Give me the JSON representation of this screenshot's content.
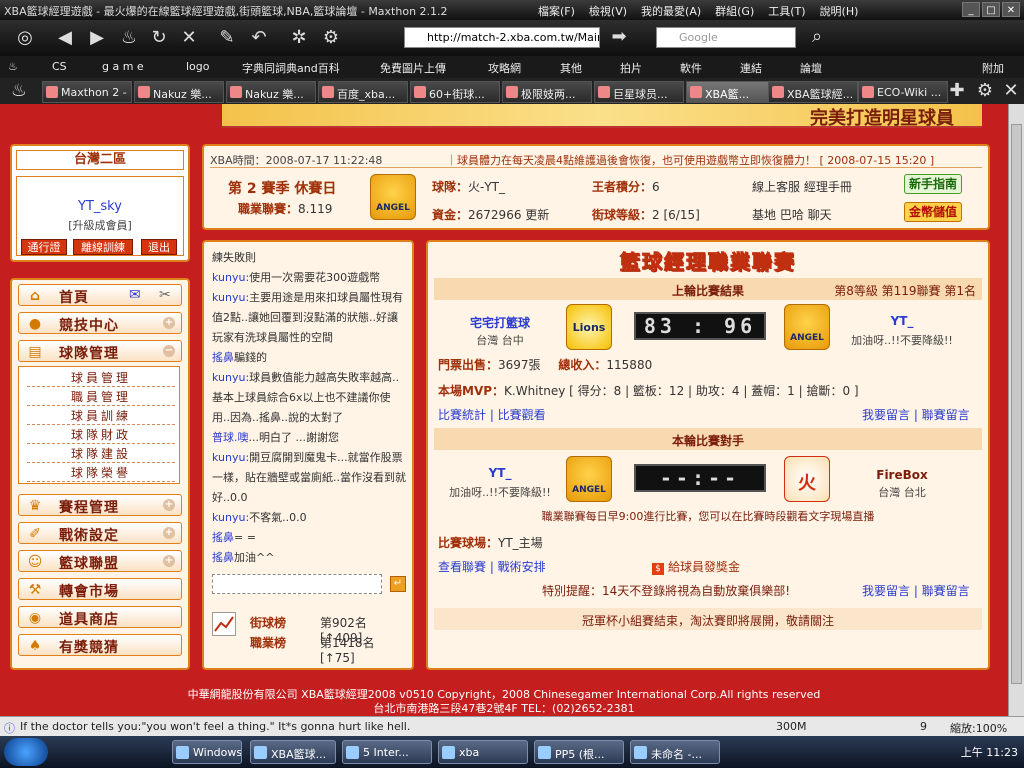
{
  "window": {
    "title": "XBA籃球經理遊戲 - 最火爆的在線籃球經理遊戲,街頭籃球,NBA,籃球論壇 - Maxthon 2.1.2",
    "menu": [
      "檔案(F)",
      "檢視(V)",
      "我的最愛(A)",
      "群組(G)",
      "工具(T)",
      "說明(H)"
    ]
  },
  "nav": {
    "url": "http://match-2.xba.com.tw/Mair",
    "search_placeholder": "Google"
  },
  "favorites": [
    "CS",
    "g a m e",
    "logo",
    "字典同詞典and百科",
    "免費圖片上傳",
    "攻略網",
    "其他",
    "拍片",
    "軟件",
    "連結",
    "論壇",
    "附加"
  ],
  "tabs": [
    "Maxthon 2 - ...",
    "Nakuz 樂...",
    "Nakuz 樂...",
    "百度_xba...",
    "60+街球...",
    "极限妓两...",
    "巨星球员...",
    "XBA籃...",
    "XBA籃球經...",
    "ECO-Wiki ..."
  ],
  "banner_text": "完美打造明星球員",
  "left": {
    "region": "台灣二區",
    "username": "YT_sky",
    "level": "[升級成會員]",
    "buttons": [
      "通行證",
      "離線訓練",
      "退出"
    ]
  },
  "menu": {
    "home": "首頁",
    "items": [
      "競技中心",
      "球隊管理",
      "賽程管理",
      "戰術設定",
      "籃球聯盟",
      "轉會市場",
      "道具商店",
      "有獎競猜"
    ],
    "sub": [
      "球員管理",
      "職員管理",
      "球員訓練",
      "球隊財政",
      "球隊建設",
      "球隊榮譽"
    ]
  },
  "info": {
    "time": "XBA時間：2008-07-17 11:22:48",
    "notice": "｜球員體力在每天凌晨4點維護過後會恢復，也可使用遊戲幣立即恢復體力！ [ 2008-07-15 15:20 ]",
    "season": "第 2 賽季  休賽日",
    "league_label": "職業聯賽：",
    "league_val": "8.119",
    "logo_text": "ANGEL",
    "team_label": "球隊：",
    "team": "火-YT_",
    "kings_label": "王者積分：",
    "kings": "6",
    "service": "線上客服  經理手冊",
    "funds_label": "資金：",
    "funds": "2672966 更新",
    "street_label": "街球等級：",
    "street": "2 [6/15]",
    "links": "基地  巴哈  聊天",
    "btn_guide": "新手指南",
    "btn_gold": "金幣儲值"
  },
  "chat": {
    "messages": [
      {
        "who": "",
        "text": "練失敗則"
      },
      {
        "who": "kunyu:",
        "text": "使用一次需要花300遊戲幣"
      },
      {
        "who": "kunyu:",
        "text": "主要用途是用來扣球員屬性現有值2點..讓她回覆到沒點滿的狀態..好讓玩家有洗球員屬性的空間"
      },
      {
        "who": "搖鼻",
        "text": "騙錢的"
      },
      {
        "who": "kunyu:",
        "text": "球員數值能力越高失敗率越高..基本上球員綜合6x以上也不建議你使用..因為..搖鼻..說的太對了"
      },
      {
        "who": "普球.噢",
        "text": "...明白了 ...謝謝您"
      },
      {
        "who": "kunyu:",
        "text": "開豆腐開到魔鬼卡...就當作股票一樣，貼在牆壁或當廁紙..當作沒看到就好..0.0"
      },
      {
        "who": "kunyu:",
        "text": "不客氣..0.0"
      },
      {
        "who": "搖鼻",
        "text": "= ="
      },
      {
        "who": "搖鼻",
        "text": "加油^^"
      }
    ],
    "rank_street_label": "街球榜",
    "rank_street": "第902名[↑409]",
    "rank_pro_label": "職業榜",
    "rank_pro": "第1418名[↑75]"
  },
  "main": {
    "heading": "籃球經理職業聯賽",
    "last_result": "上輪比賽結果",
    "last_meta": "第8等級  第119聯賽  第1名",
    "home_team": "宅宅打籃球",
    "home_loc": "台灣 台中",
    "home_logo": "Lions",
    "score": "83 : 96",
    "away_team": "YT_",
    "away_motto": "加油呀..!!不要降級!!",
    "away_logo": "ANGEL",
    "tickets_label": "門票出售：",
    "tickets": "3697張",
    "revenue_label": "總收入：",
    "revenue": "115880",
    "mvp_label": "本場MVP：",
    "mvp": "K.Whitney  [ 得分：8 | 籃板：12 | 助攻：4 | 蓋帽：1 | 搶斷：0 ]",
    "stats_links": "比賽統計 | 比賽觀看",
    "msg_links": "我要留言 | 聯賽留言",
    "next_title": "本輪比賽對手",
    "next_home": "YT_",
    "next_home_motto": "加油呀..!!不要降級!!",
    "next_home_logo": "ANGEL",
    "next_score": "--:--",
    "next_away": "FireBox",
    "next_away_loc": "台灣  台北",
    "next_away_logo": "火",
    "schedule_note": "職業聯賽每日早9:00進行比賽，您可以在比賽時段觀看文字現場直播",
    "venue_label": "比賽球場：",
    "venue": "YT_主場",
    "view_links": "查看聯賽 | 戰術安排",
    "bonus": "給球員發獎金",
    "warn_label": "特別提醒：",
    "warn": "14天不登錄將視為自動放棄俱樂部!",
    "msg_links2": "我要留言 | 聯賽留言",
    "cup_notice": "冠軍杯小組賽結束，淘汰賽即將展開，敬請關注"
  },
  "footer": {
    "line1": "中華網龍股份有限公司  XBA籃球經理2008 v0510     Copyright，2008 Chinesegamer International Corp.All rights reserved",
    "line2": "台北市南港路三段47巷2號4F TEL：(02)2652-2381"
  },
  "status": {
    "text": "If the doctor tells you:\"you won't feel a thing.\" It*s gonna hurt like hell.",
    "mem": "300M",
    "count": "9",
    "zoom": "縮放:100%"
  },
  "taskbar": {
    "items": [
      "Windows...",
      "XBA籃球...",
      "5 Inter...",
      "xba",
      "PP5 (根...",
      "未命名 -..."
    ],
    "clock": "上午 11:23"
  }
}
